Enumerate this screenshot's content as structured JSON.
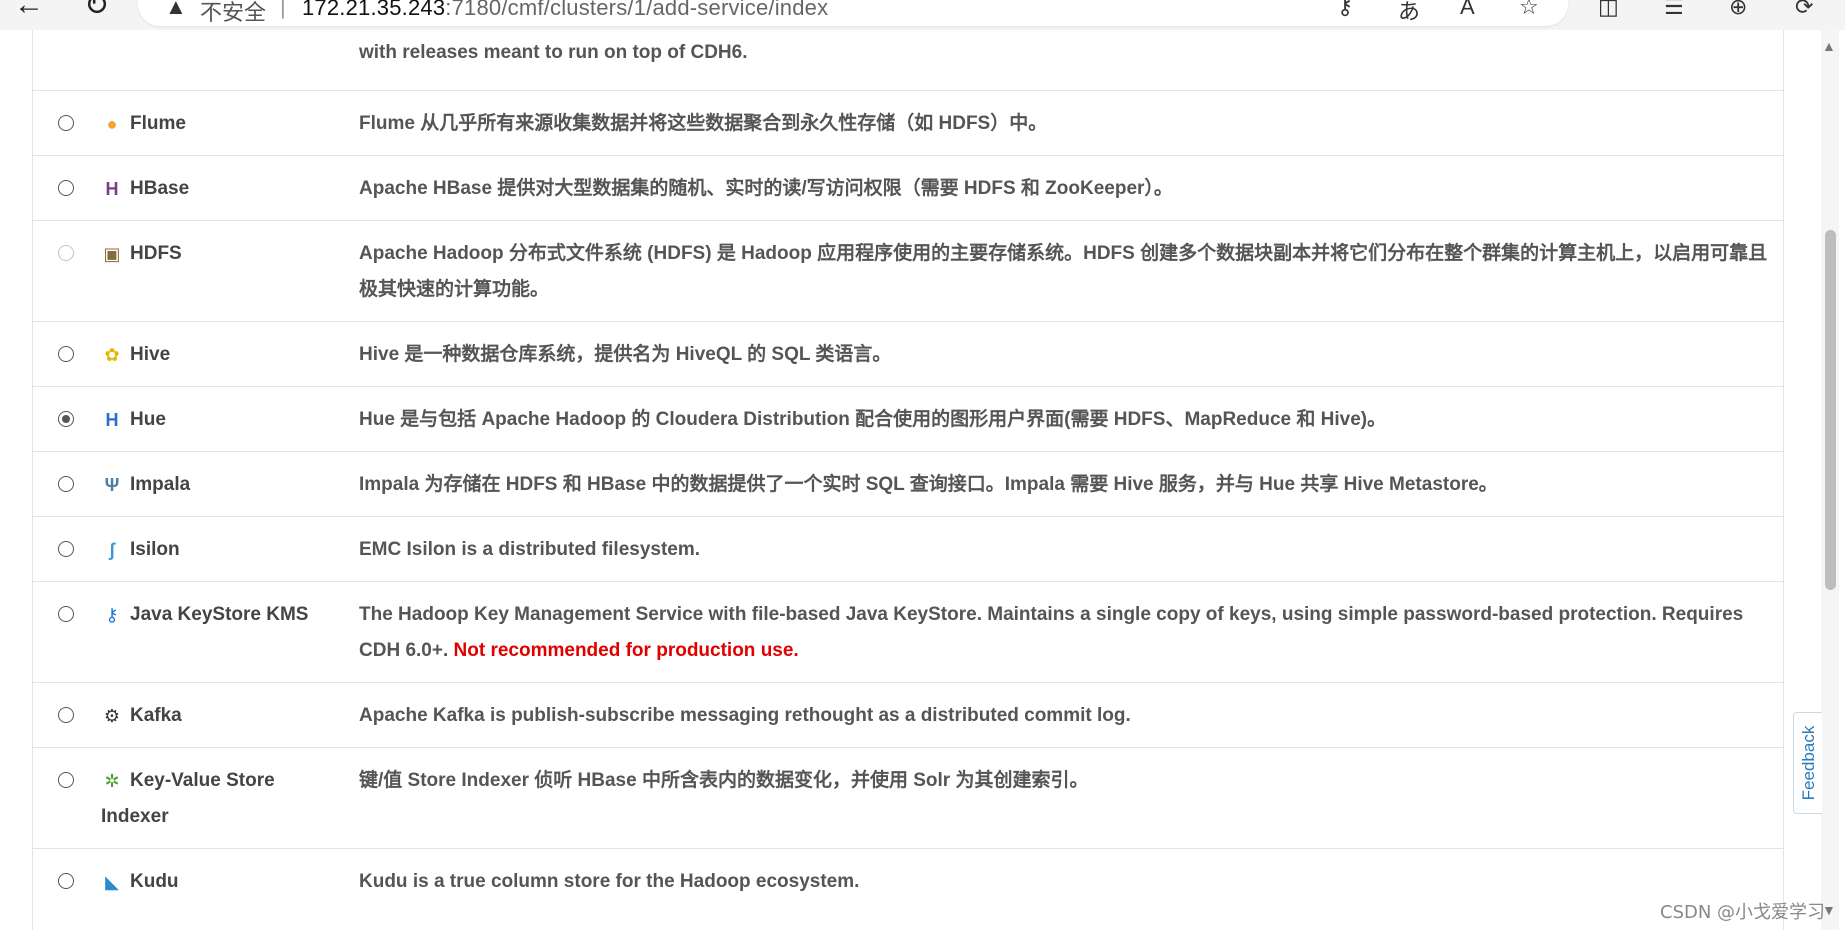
{
  "browser": {
    "back_icon": "←",
    "reload_icon": "↻",
    "warning_icon": "▲",
    "insecure_label": "不安全",
    "separator": "|",
    "url_host": "172.21.35.243",
    "url_path": ":7180/cmf/clusters/1/add-service/index",
    "tools": [
      "⚷",
      "あ",
      "A",
      "☆",
      "◫",
      "☰",
      "⊕",
      "⟳"
    ]
  },
  "services": [
    {
      "name": "",
      "icon": "",
      "description": "with releases meant to run on top of CDH6.",
      "radio": "none"
    },
    {
      "name": "Flume",
      "icon": "flume-icon",
      "icon_glyph": "●",
      "icon_color": "#f0a630",
      "description": "Flume 从几乎所有来源收集数据并将这些数据聚合到永久性存储（如 HDFS）中。",
      "radio": "unchecked"
    },
    {
      "name": "HBase",
      "icon": "hbase-icon",
      "icon_glyph": "H",
      "icon_color": "#7a3b8c",
      "description": "Apache HBase 提供对大型数据集的随机、实时的读/写访问权限（需要 HDFS 和 ZooKeeper）。",
      "radio": "unchecked"
    },
    {
      "name": "HDFS",
      "icon": "hdfs-icon",
      "icon_glyph": "▣",
      "icon_color": "#8a6a3a",
      "description": "Apache Hadoop 分布式文件系统 (HDFS) 是 Hadoop 应用程序使用的主要存储系统。HDFS 创建多个数据块副本并将它们分布在整个群集的计算主机上，以启用可靠且极其快速的计算功能。",
      "radio": "disabled"
    },
    {
      "name": "Hive",
      "icon": "hive-icon",
      "icon_glyph": "✿",
      "icon_color": "#e3b800",
      "description": "Hive 是一种数据仓库系统，提供名为 HiveQL 的 SQL 类语言。",
      "radio": "unchecked"
    },
    {
      "name": "Hue",
      "icon": "hue-icon",
      "icon_glyph": "H",
      "icon_color": "#2a6cc8",
      "description": "Hue 是与包括 Apache Hadoop 的 Cloudera Distribution 配合使用的图形用户界面(需要 HDFS、MapReduce 和 Hive)。",
      "radio": "checked"
    },
    {
      "name": "Impala",
      "icon": "impala-icon",
      "icon_glyph": "Ψ",
      "icon_color": "#4a7fa8",
      "description": "Impala 为存储在 HDFS 和 HBase 中的数据提供了一个实时 SQL 查询接口。Impala 需要 Hive 服务，并与 Hue 共享 Hive Metastore。",
      "radio": "unchecked"
    },
    {
      "name": "Isilon",
      "icon": "isilon-icon",
      "icon_glyph": "ʃ",
      "icon_color": "#3a9ad0",
      "description": "EMC Isilon is a distributed filesystem.",
      "radio": "unchecked"
    },
    {
      "name": "Java KeyStore KMS",
      "icon": "key-icon",
      "icon_glyph": "⚷",
      "icon_color": "#1a7ad0",
      "description": "The Hadoop Key Management Service with file-based Java KeyStore. Maintains a single copy of keys, using simple password-based protection. Requires CDH 6.0+.",
      "warning": "Not recommended for production use.",
      "radio": "unchecked"
    },
    {
      "name": "Kafka",
      "icon": "kafka-icon",
      "icon_glyph": "⚙",
      "icon_color": "#333333",
      "description": "Apache Kafka is publish-subscribe messaging rethought as a distributed commit log.",
      "radio": "unchecked"
    },
    {
      "name": "Key-Value Store Indexer",
      "icon": "indexer-icon",
      "icon_glyph": "✲",
      "icon_color": "#4aa030",
      "description": "键/值 Store Indexer 侦听 HBase 中所含表内的数据变化，并使用 Solr 为其创建索引。",
      "radio": "unchecked"
    },
    {
      "name": "Kudu",
      "icon": "kudu-icon",
      "icon_glyph": "◣",
      "icon_color": "#2a8ad0",
      "description": "Kudu is a true column store for the Hadoop ecosystem.",
      "radio": "unchecked"
    }
  ],
  "feedback_label": "Feedback",
  "watermark": "CSDN @小戈爱学习",
  "scroll_up_glyph": "▲",
  "scroll_down_glyph": "▼"
}
